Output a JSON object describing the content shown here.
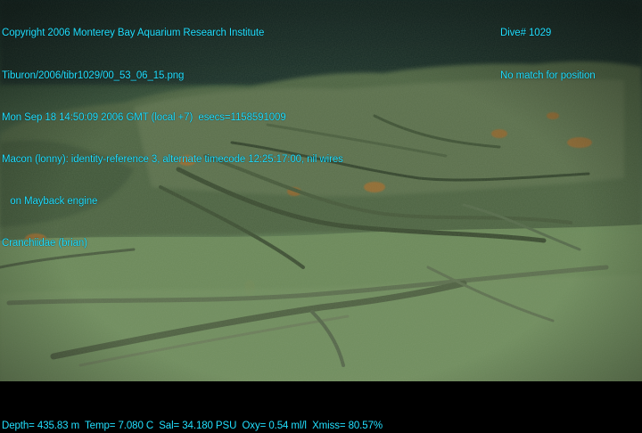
{
  "overlay": {
    "left_lines": [
      "Copyright 2006 Monterey Bay Aquarium Research Institute",
      "Tiburon/2006/tibr1029/00_53_06_15.png",
      "Mon Sep 18 14:50:09 2006 GMT (local +7)  esecs=1158591009",
      "Macon (lonny): identity-reference 3, alternate timecode 12:25:17:00, nil wires",
      "   on Mayback engine",
      "Cranchiidae (brian)"
    ],
    "right_lines": [
      "Dive# 1029",
      "No match for position"
    ],
    "bottom_line": "Depth= 435.83 m  Temp= 7.080 C  Sal= 34.180 PSU  Oxy= 0.54 ml/l  Xmiss= 80.57%"
  },
  "colors": {
    "overlay_text": "#22e0ff",
    "water_top": "#1c3a2e",
    "seafloor": "#6f8a5e",
    "wreck_orange": "#b8742e"
  }
}
